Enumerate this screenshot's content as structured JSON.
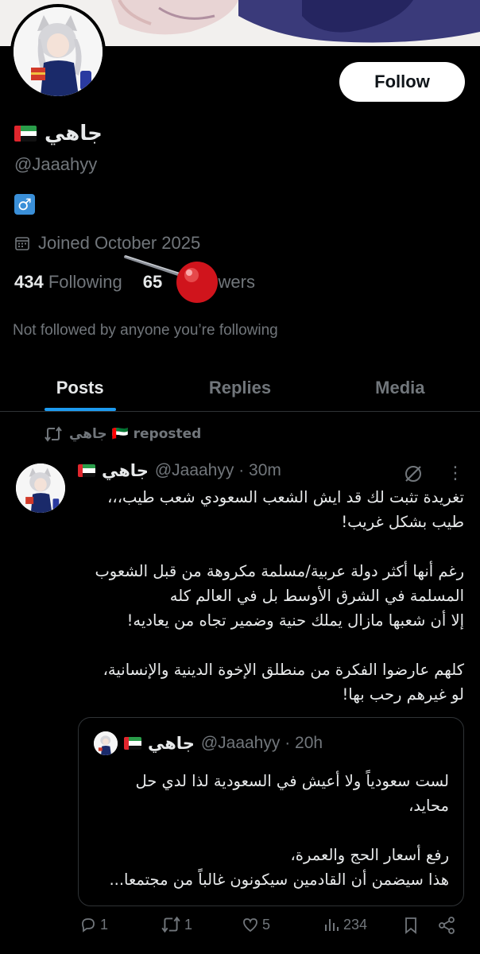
{
  "profile": {
    "display_name": "جاهي",
    "handle": "@Jaaahyy",
    "bio_symbol": "♂",
    "joined": "Joined October 2025",
    "following_count": "434",
    "following_label": "Following",
    "followers_count": "65",
    "followers_label": "owers",
    "not_followed_text": "Not followed by anyone you’re following",
    "follow_button": "Follow"
  },
  "tabs": [
    {
      "label": "Posts",
      "active": true
    },
    {
      "label": "Replies",
      "active": false
    },
    {
      "label": "Media",
      "active": false
    }
  ],
  "post": {
    "repost_label": "جاهي 🇦🇪 reposted",
    "author_name": "جاهي",
    "author_meta": "@Jaaahyy · 30m",
    "body": "تغريدة تثبت لك قد ايش الشعب السعودي شعب طيب،،،\nطيب بشكل غريب!\n\nرغم أنها أكثر دولة عربية/مسلمة مكروهة من قبل الشعوب المسلمة في الشرق الأوسط بل في العالم كله\nإلا أن شعبها مازال يملك حنية وضمير تجاه من يعاديه!\n\nكلهم عارضوا الفكرة من منطلق الإخوة الدينية والإنسانية،\nلو غيرهم رحب بها!",
    "quote": {
      "author_name": "جاهي",
      "author_meta": "@Jaaahyy · 20h",
      "body": "لست سعودياً ولا أعيش في السعودية لذا لدي حل محايد،\n\nرفع أسعار الحج والعمرة،\nهذا سيضمن أن القادمين سيكونون غالباً من مجتمعا..."
    },
    "actions": {
      "replies": "1",
      "reposts": "1",
      "likes": "5",
      "views": "234"
    }
  },
  "icons": {
    "calendar": "calendar-icon",
    "repost": "repost-icon",
    "reply": "reply-icon",
    "like": "heart-icon",
    "views": "views-icon",
    "bookmark": "bookmark-icon",
    "share": "share-icon",
    "grok": "grok-icon",
    "more": "more-icon"
  },
  "colors": {
    "accent": "#1d9bf0",
    "background": "#000000",
    "muted": "#71767b"
  }
}
